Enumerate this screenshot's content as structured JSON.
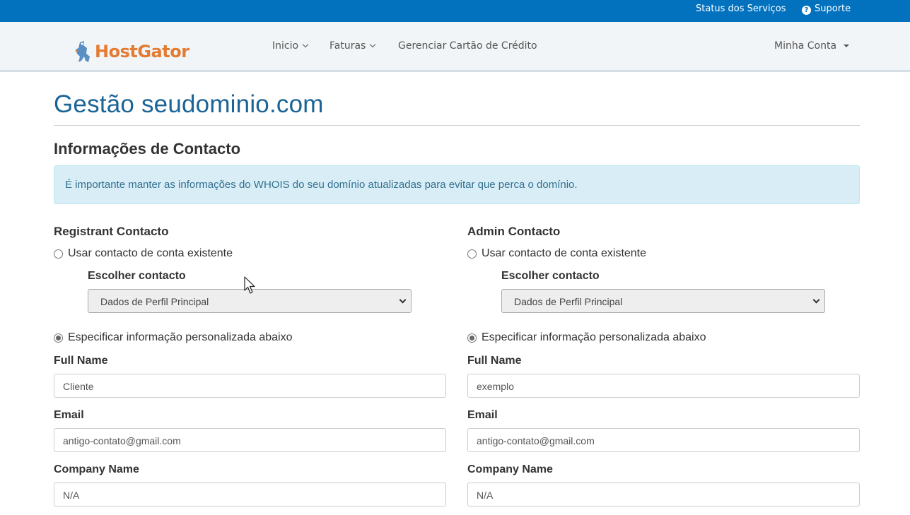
{
  "topbar": {
    "status_label": "Status dos Serviços",
    "support_label": "Suporte",
    "support_icon": "question-circle-icon",
    "bg_color": "#0272bf"
  },
  "navbar": {
    "logo_text": "HostGator",
    "items": [
      {
        "label": "Inicio"
      },
      {
        "label": "Faturas"
      },
      {
        "label": "Gerenciar Cartão de Crédito"
      }
    ],
    "account_label": "Minha Conta"
  },
  "page": {
    "title": "Gestão seudominio.com",
    "section_title": "Informações de Contacto",
    "alert_text": "É importante manter as informações do WHOIS do seu domínio atualizadas para evitar que perca o domínio."
  },
  "contacts": [
    {
      "title": "Registrant Contacto",
      "use_existing_label": "Usar contacto de conta existente",
      "choose_label": "Escolher contacto",
      "selected_contact": "Dados de Perfil Principal",
      "custom_label": "Especificar informação personalizada abaixo",
      "full_name_label": "Full Name",
      "full_name_value": "Cliente",
      "email_label": "Email",
      "email_value": "antigo-contato@gmail.com",
      "company_label": "Company Name",
      "company_value": "N/A"
    },
    {
      "title": "Admin Contacto",
      "use_existing_label": "Usar contacto de conta existente",
      "choose_label": "Escolher contacto",
      "selected_contact": "Dados de Perfil Principal",
      "custom_label": "Especificar informação personalizada abaixo",
      "full_name_label": "Full Name",
      "full_name_value": "exemplo",
      "email_label": "Email",
      "email_value": "antigo-contato@gmail.com",
      "company_label": "Company Name",
      "company_value": "N/A"
    }
  ]
}
